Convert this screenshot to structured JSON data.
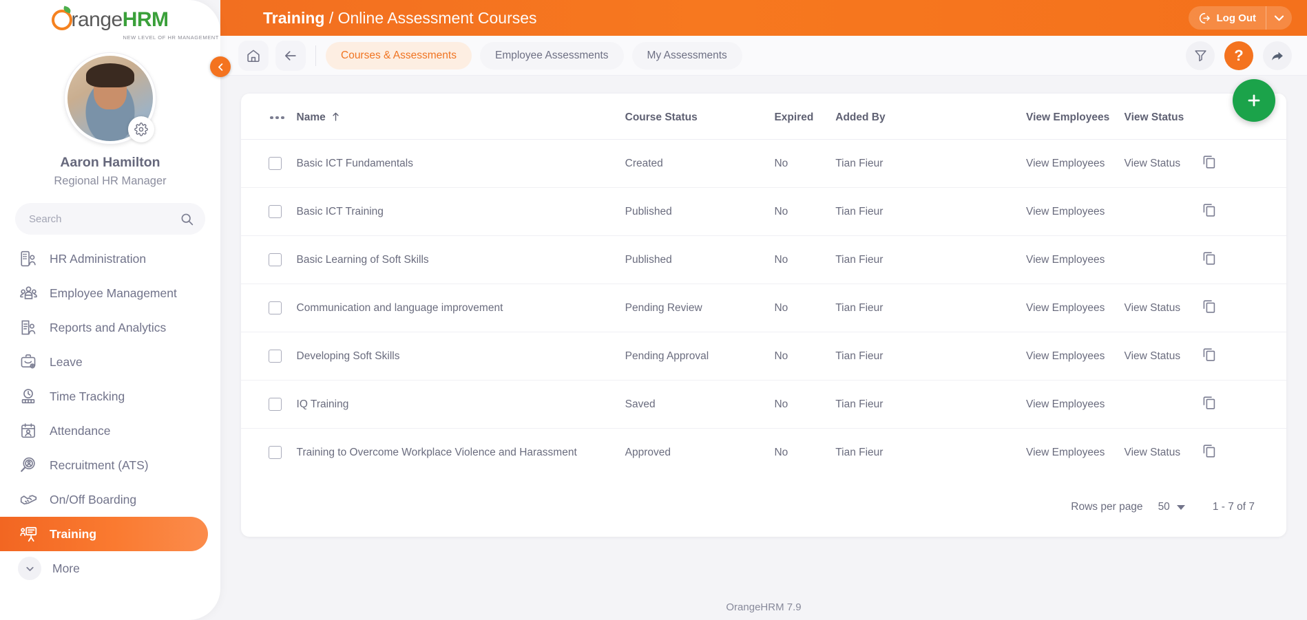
{
  "brand": {
    "logo_o": "orange-o-icon",
    "name_part1": "range",
    "name_part2": "HRM",
    "tagline": "NEW LEVEL OF HR MANAGEMENT"
  },
  "sidebar": {
    "avatar": "user-avatar",
    "gear_icon": "gear-icon",
    "user_name": "Aaron Hamilton",
    "user_role": "Regional HR Manager",
    "search": {
      "placeholder": "Search",
      "value": "",
      "icon": "search-icon"
    },
    "collapse_icon": "chevron-left-icon",
    "items": [
      {
        "label": "HR Administration",
        "icon": "building-user-icon",
        "active": false
      },
      {
        "label": "Employee Management",
        "icon": "people-group-icon",
        "active": false
      },
      {
        "label": "Reports and Analytics",
        "icon": "report-user-icon",
        "active": false
      },
      {
        "label": "Leave",
        "icon": "briefcase-gear-icon",
        "active": false
      },
      {
        "label": "Time Tracking",
        "icon": "clock-bars-icon",
        "active": false
      },
      {
        "label": "Attendance",
        "icon": "calendar-user-icon",
        "active": false
      },
      {
        "label": "Recruitment (ATS)",
        "icon": "magnifier-user-icon",
        "active": false
      },
      {
        "label": "On/Off Boarding",
        "icon": "handshake-icon",
        "active": false
      },
      {
        "label": "Training",
        "icon": "presentation-icon",
        "active": true
      }
    ],
    "more_label": "More",
    "more_icon": "chevron-down-icon"
  },
  "topbar": {
    "title_bold": "Training",
    "title_light": "/ Online Assessment Courses",
    "logout_label": "Log Out",
    "logout_icon": "logout-icon",
    "logout_caret_icon": "caret-down-icon"
  },
  "subbar": {
    "home_icon": "home-icon",
    "back_icon": "arrow-left-icon",
    "tabs": [
      {
        "label": "Courses & Assessments",
        "active": true
      },
      {
        "label": "Employee Assessments",
        "active": false
      },
      {
        "label": "My Assessments",
        "active": false
      }
    ],
    "actions": [
      {
        "name": "filter-icon",
        "style": "plain"
      },
      {
        "name": "help-icon",
        "style": "accent",
        "glyph": "?"
      },
      {
        "name": "share-icon",
        "style": "plain"
      }
    ]
  },
  "fab": {
    "icon": "plus-icon",
    "color": "#1ba34a"
  },
  "table": {
    "menu_icon": "more-options-icon",
    "sort_icon": "sort-ascending-icon",
    "columns": [
      "Name",
      "Course Status",
      "Expired",
      "Added By",
      "View Employees",
      "View Status"
    ],
    "rows": [
      {
        "name": "Basic ICT Fundamentals",
        "status": "Created",
        "expired": "No",
        "added_by": "Tian Fieur",
        "view_employees": "View Employees",
        "view_status": "View Status",
        "action_icon": "copy-icon"
      },
      {
        "name": "Basic ICT Training",
        "status": "Published",
        "expired": "No",
        "added_by": "Tian Fieur",
        "view_employees": "View Employees",
        "view_status": "",
        "action_icon": "copy-icon"
      },
      {
        "name": "Basic Learning of Soft Skills",
        "status": "Published",
        "expired": "No",
        "added_by": "Tian Fieur",
        "view_employees": "View Employees",
        "view_status": "",
        "action_icon": "copy-icon"
      },
      {
        "name": "Communication and language improvement",
        "status": "Pending Review",
        "expired": "No",
        "added_by": "Tian Fieur",
        "view_employees": "View Employees",
        "view_status": "View Status",
        "action_icon": "copy-icon"
      },
      {
        "name": "Developing Soft Skills",
        "status": "Pending Approval",
        "expired": "No",
        "added_by": "Tian Fieur",
        "view_employees": "View Employees",
        "view_status": "View Status",
        "action_icon": "copy-icon"
      },
      {
        "name": "IQ Training",
        "status": "Saved",
        "expired": "No",
        "added_by": "Tian Fieur",
        "view_employees": "View Employees",
        "view_status": "",
        "action_icon": "copy-icon"
      },
      {
        "name": "Training to Overcome Workplace Violence and Harassment",
        "status": "Approved",
        "expired": "No",
        "added_by": "Tian Fieur",
        "view_employees": "View Employees",
        "view_status": "View Status",
        "action_icon": "copy-icon"
      }
    ]
  },
  "pagination": {
    "rows_per_page_label": "Rows per page",
    "rows_per_page_value": "50",
    "range_text": "1 - 7 of 7"
  },
  "footer": {
    "text": "OrangeHRM 7.9"
  },
  "colors": {
    "accent_orange": "#f4731f",
    "header_orange": "#f7781f",
    "active_green": "#1ba34a",
    "text_muted": "#6a6c7e"
  }
}
